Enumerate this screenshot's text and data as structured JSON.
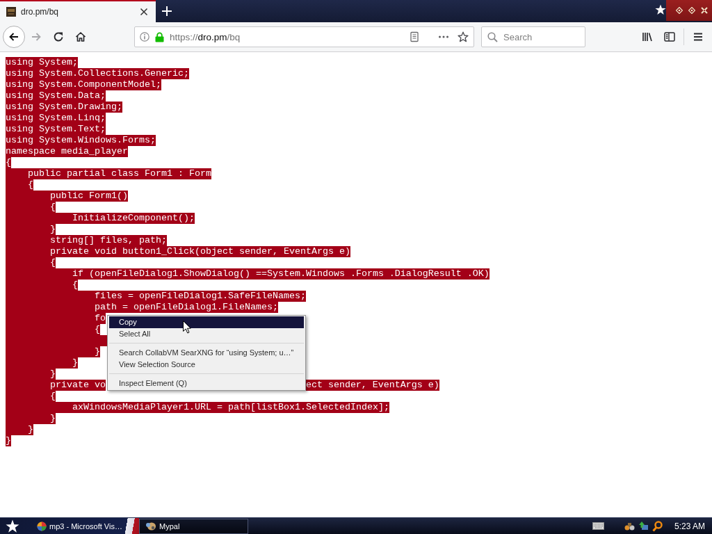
{
  "browser": {
    "tabs": [
      {
        "title": "dro.pm/bq",
        "selected": true
      }
    ],
    "toolbar": {
      "back": {
        "disabled": false
      },
      "forward": {
        "disabled": true
      },
      "url": {
        "prefix": "https://",
        "domain": "dro.pm",
        "suffix": "/bq"
      },
      "search": {
        "placeholder": "Search"
      }
    }
  },
  "page": {
    "code_lines": [
      {
        "kind": "text",
        "text": "using System;",
        "selected": true
      },
      {
        "kind": "text",
        "text": "using System.Collections.Generic;",
        "selected": true
      },
      {
        "kind": "text",
        "text": "using System.ComponentModel;",
        "selected": true
      },
      {
        "kind": "text",
        "text": "using System.Data;",
        "selected": true
      },
      {
        "kind": "text",
        "text": "using System.Drawing;",
        "selected": true
      },
      {
        "kind": "text",
        "text": "using System.Linq;",
        "selected": true
      },
      {
        "kind": "text",
        "text": "using System.Text;",
        "selected": true
      },
      {
        "kind": "text",
        "text": "using System.Windows.Forms;",
        "selected": true
      },
      {
        "kind": "text",
        "text": "namespace media_player",
        "selected": true
      },
      {
        "kind": "text",
        "text": "{",
        "selected": true
      },
      {
        "kind": "text",
        "text": "    public partial class Form1 : Form",
        "selected": true
      },
      {
        "kind": "text",
        "text": "    {",
        "selected": true
      },
      {
        "kind": "text",
        "text": "        public Form1()",
        "selected": true
      },
      {
        "kind": "text",
        "text": "        {",
        "selected": true
      },
      {
        "kind": "text",
        "text": "            InitializeComponent();",
        "selected": true
      },
      {
        "kind": "text",
        "text": "        }",
        "selected": true
      },
      {
        "kind": "text",
        "text": "        string[] files, path;",
        "selected": true
      },
      {
        "kind": "text",
        "text": "        private void button1_Click(object sender, EventArgs e)",
        "selected": true
      },
      {
        "kind": "text",
        "text": "        {",
        "selected": true
      },
      {
        "kind": "text",
        "text": "            if (openFileDialog1.ShowDialog() ==System.Windows .Forms .DialogResult .OK)",
        "selected": true
      },
      {
        "kind": "text",
        "text": "            {",
        "selected": true
      },
      {
        "kind": "text",
        "text": "                files = openFileDialog1.SafeFileNames;",
        "selected": true
      },
      {
        "kind": "text",
        "text": "                path = openFileDialog1.FileNames;",
        "selected": true
      },
      {
        "kind": "text",
        "text": "                fo",
        "selected": true
      },
      {
        "kind": "text",
        "text": "                {",
        "selected": true
      },
      {
        "kind": "covered",
        "selected": true
      },
      {
        "kind": "text",
        "text": "                }",
        "selected": true
      },
      {
        "kind": "text",
        "text": "            }",
        "selected": true
      },
      {
        "kind": "text",
        "text": "        }",
        "selected": true
      },
      {
        "kind": "text",
        "text": "        private vo",
        "text_after_menu": "ect sender, EventArgs e)",
        "selected": true
      },
      {
        "kind": "text",
        "text": "        {",
        "selected": true
      },
      {
        "kind": "text",
        "text": "            axWindowsMediaPlayer1.URL = path[listBox1.SelectedIndex];",
        "selected": true
      },
      {
        "kind": "text",
        "text": "        }",
        "selected": true
      },
      {
        "kind": "text",
        "text": "    }",
        "selected": true
      },
      {
        "kind": "text",
        "text": "}",
        "selected": true
      }
    ]
  },
  "context_menu": {
    "groups": [
      {
        "items": [
          {
            "label": "Copy",
            "selected": true
          },
          {
            "label": "Select All",
            "selected": false
          }
        ]
      },
      {
        "items": [
          {
            "label": "Search CollabVM SearXNG for “using System; u…”",
            "selected": false
          },
          {
            "label": "View Selection Source",
            "selected": false
          }
        ]
      },
      {
        "items": [
          {
            "label": "Inspect Element (Q)",
            "selected": false
          }
        ]
      }
    ]
  },
  "taskbar": {
    "buttons": [
      {
        "label": "mp3 - Microsoft Vis…",
        "selected": false
      },
      {
        "label": "Mypal",
        "selected": true
      }
    ],
    "clock": "5:23 AM"
  }
}
